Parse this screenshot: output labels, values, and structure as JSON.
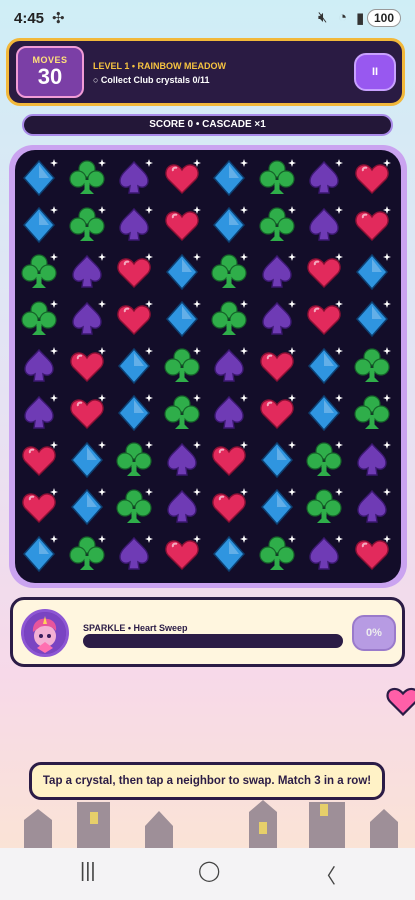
{
  "status": {
    "time": "4:45",
    "battery": "100"
  },
  "hud": {
    "moves_label": "MOVES",
    "moves_value": "30",
    "level": "LEVEL 1 • RAINBOW MEADOW",
    "goal": "○ Collect Club crystals 0/11",
    "pause_label": "II"
  },
  "score_text": "SCORE 0 • CASCADE ×1",
  "board": {
    "rows": [
      [
        "diamond",
        "club",
        "spade",
        "heart",
        "diamond",
        "club",
        "spade",
        "heart"
      ],
      [
        "diamond",
        "club",
        "spade",
        "heart",
        "diamond",
        "club",
        "spade",
        "heart"
      ],
      [
        "club",
        "spade",
        "heart",
        "diamond",
        "club",
        "spade",
        "heart",
        "diamond"
      ],
      [
        "club",
        "spade",
        "heart",
        "diamond",
        "club",
        "spade",
        "heart",
        "diamond"
      ],
      [
        "spade",
        "heart",
        "diamond",
        "club",
        "spade",
        "heart",
        "diamond",
        "club"
      ],
      [
        "spade",
        "heart",
        "diamond",
        "club",
        "spade",
        "heart",
        "diamond",
        "club"
      ],
      [
        "heart",
        "diamond",
        "club",
        "spade",
        "heart",
        "diamond",
        "club",
        "spade"
      ],
      [
        "heart",
        "diamond",
        "club",
        "spade",
        "heart",
        "diamond",
        "club",
        "spade"
      ],
      [
        "diamond",
        "club",
        "spade",
        "heart",
        "diamond",
        "club",
        "spade",
        "heart"
      ]
    ],
    "colors": {
      "diamond": "#2f95e0",
      "club": "#2fae4a",
      "spade": "#6f3bb5",
      "heart": "#e22a5c"
    }
  },
  "power": {
    "title": "SPARKLE • Heart Sweep",
    "percent_label": "0%",
    "fill": 0
  },
  "hint": "Tap a crystal, then tap a neighbor to swap. Match 3 in a row!"
}
